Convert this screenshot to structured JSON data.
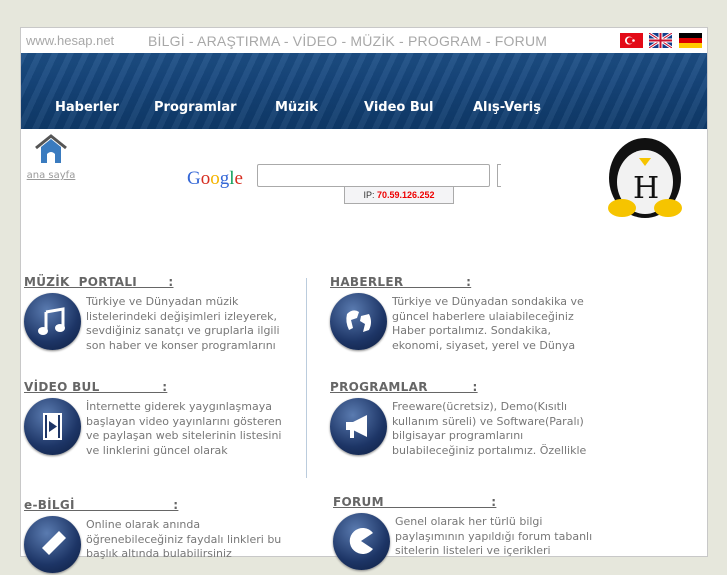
{
  "topbar": {
    "site": "www.hesap.net",
    "tagline": "BİLGİ - ARAŞTIRMA - VİDEO - MÜZİK - PROGRAM - FORUM",
    "flags": [
      "turkish-flag",
      "uk-flag",
      "german-flag"
    ]
  },
  "nav": [
    "Haberler",
    "Programlar",
    "Müzik",
    "Video Bul",
    "Alış-Veriş"
  ],
  "home": {
    "label": "ana sayfa"
  },
  "search": {
    "logo": "Google",
    "value": "",
    "ip_label": "IP:",
    "ip_value": "70.59.126.252"
  },
  "sections": [
    {
      "title": "MÜZİK  PORTALI       :",
      "icon": "music-note-icon",
      "text": "Türkiye ve Dünyadan müzik listelerindeki değişimleri izleyerek, sevdiğiniz sanatçı ve gruplarla ilgili son haber ve konser programlarını bu bölümümüzde kolayca"
    },
    {
      "title": "HABERLER              :",
      "icon": "globe-icon",
      "text": "Türkiye ve Dünyadan sondakika ve güncel haberlere ulaiabileceğiniz Haber portalımız. Sondakika, ekonomi, siyaset, yerel ve Dünya haberlerine ulaşmanıza"
    },
    {
      "title": "VİDEO BUL              :",
      "icon": "video-film-icon",
      "text": "İnternette giderek yaygınlaşmaya başlayan video yayınlarını gösteren ve paylaşan web sitelerinin listesini ve linklerini güncel olarak bulabileceğiniz bir bölüm"
    },
    {
      "title": "PROGRAMLAR          :",
      "icon": "megaphone-icon",
      "text": "Freeware(ücretsiz), Demo(Kısıtlı kullanım süreli) ve Software(Paralı) bilgisayar programlarını bulabileceğiniz  portalımız. Özellikle bilgisayarınıza format attık"
    },
    {
      "title": "e-BİLGİ                      :",
      "icon": "pencil-icon",
      "text": "Online olarak anında öğrenebileceğiniz faydalı linkleri bu başlık altında bulabilirsiniz"
    },
    {
      "title": "FORUM                        :",
      "icon": "pacman-icon",
      "text": "Genel olarak her türlü bilgi paylaşımının yapıldığı forum tabanlı sitelerin listeleri ve içerikleri"
    }
  ]
}
